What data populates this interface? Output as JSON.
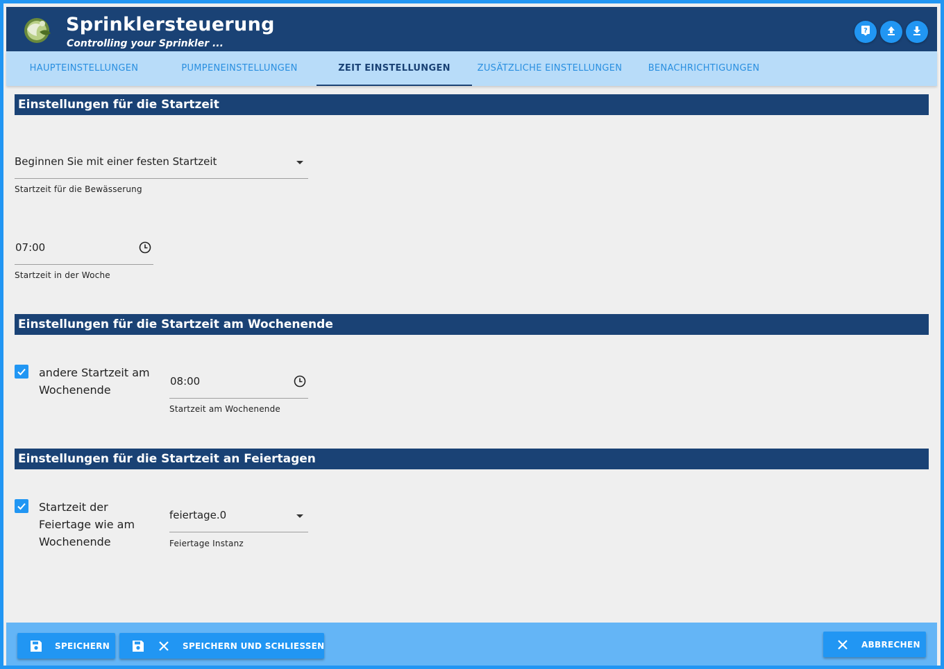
{
  "header": {
    "title": "Sprinklersteuerung",
    "subtitle": "Controlling your Sprinkler ...",
    "icons": [
      "help-icon",
      "upload-icon",
      "download-icon"
    ]
  },
  "tabs": [
    {
      "label": "HAUPTEINSTELLUNGEN",
      "active": false
    },
    {
      "label": "PUMPENEINSTELLUNGEN",
      "active": false
    },
    {
      "label": "ZEIT EINSTELLUNGEN",
      "active": true
    },
    {
      "label": "ZUSÄTZLICHE EINSTELLUNGEN",
      "active": false
    },
    {
      "label": "BENACHRICHTIGUNGEN",
      "active": false
    }
  ],
  "section_start": {
    "title": "Einstellungen für die Startzeit",
    "mode_select": {
      "value": "Beginnen Sie mit einer festen Startzeit",
      "helper": "Startzeit für die Bewässerung"
    },
    "week_time": {
      "value": "07:00",
      "helper": "Startzeit in der Woche"
    }
  },
  "section_weekend": {
    "title": "Einstellungen für die Startzeit am Wochenende",
    "checkbox": {
      "checked": true,
      "label_line1": "andere Startzeit am",
      "label_line2": "Wochenende"
    },
    "weekend_time": {
      "value": "08:00",
      "helper": "Startzeit am Wochenende"
    }
  },
  "section_holiday": {
    "title": "Einstellungen für die Startzeit an Feiertagen",
    "checkbox": {
      "checked": true,
      "label_line1": "Startzeit der",
      "label_line2": "Feiertage wie am",
      "label_line3": "Wochenende"
    },
    "instance_select": {
      "value": "feiertage.0",
      "helper": "Feiertage Instanz"
    }
  },
  "footer": {
    "save_label": "SPEICHERN",
    "save_close_label": "SPEICHERN UND SCHLIESSEN",
    "cancel_label": "ABBRECHEN"
  },
  "colors": {
    "primary": "#1a4275",
    "accent": "#2196f3",
    "tabs_bg": "#b8dcf9",
    "footer_bg": "#64b5f6"
  }
}
